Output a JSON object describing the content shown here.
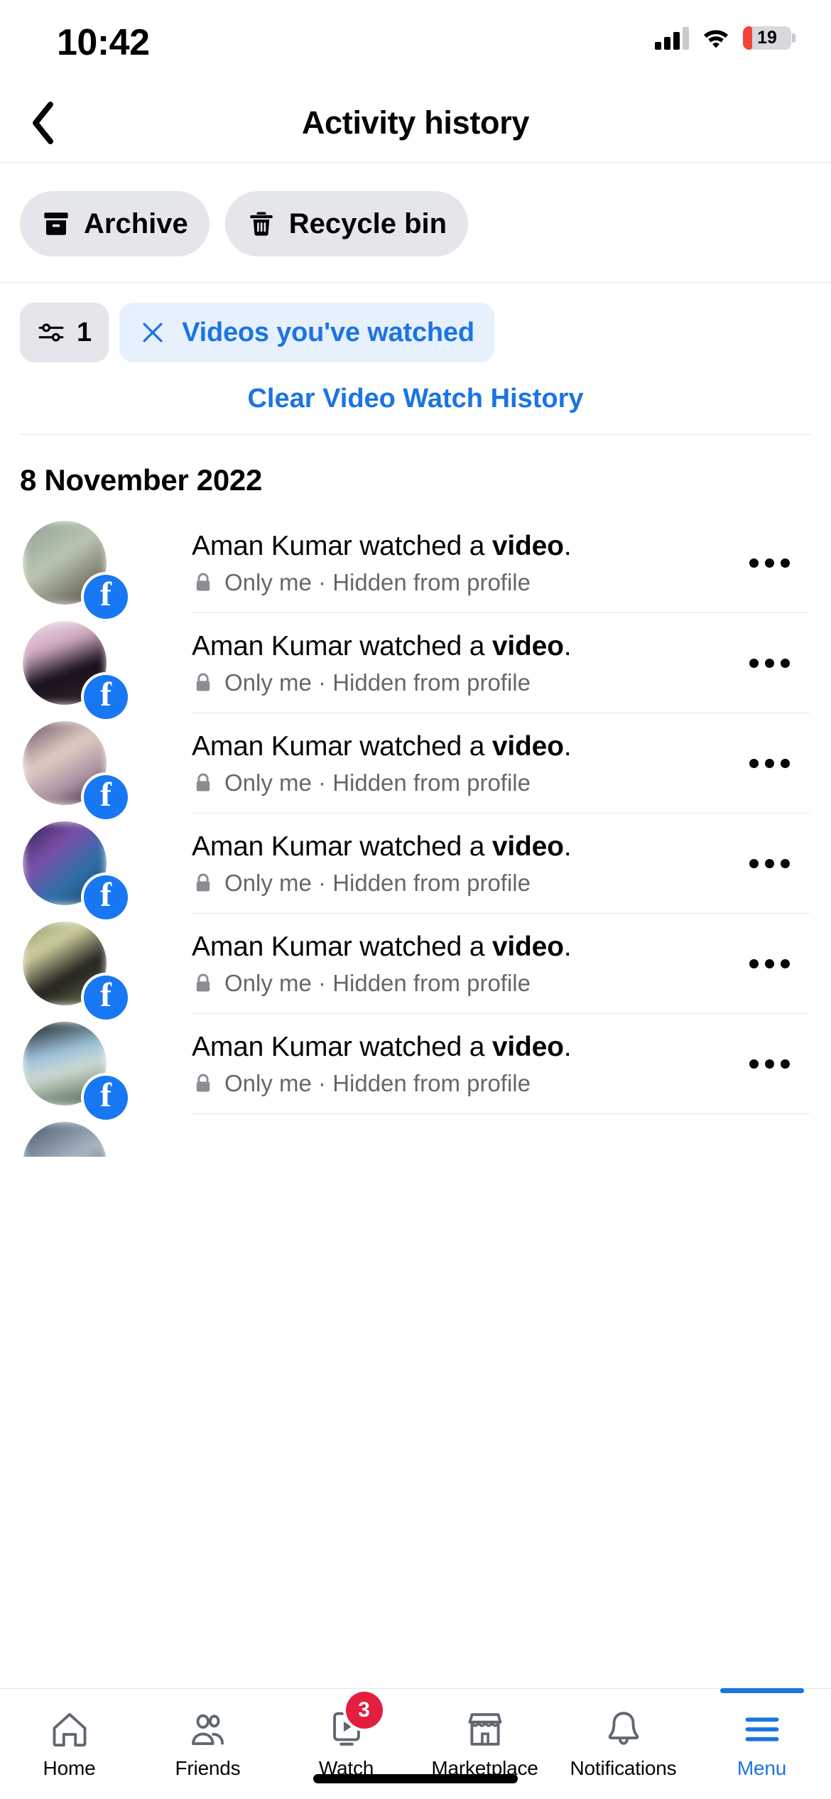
{
  "status_bar": {
    "time": "10:42",
    "battery_percent": "19",
    "battery_level_pct": 19,
    "signal_icon": "cellular-signal-icon",
    "wifi_icon": "wifi-icon",
    "battery_icon": "battery-low-icon"
  },
  "header": {
    "back_icon": "chevron-left-icon",
    "title": "Activity history"
  },
  "chips": [
    {
      "label": "Archive",
      "icon": "archive-box-icon"
    },
    {
      "label": "Recycle bin",
      "icon": "trash-can-icon"
    }
  ],
  "filters": {
    "filter_button": {
      "icon": "sliders-filter-icon",
      "count": "1"
    },
    "active_filter": {
      "close_icon": "close-x-icon",
      "label": "Videos you've watched"
    },
    "clear_link": "Clear Video Watch History"
  },
  "sections": [
    {
      "date": "8 November 2022",
      "items": [
        {
          "avatar_colors": [
            "#8e9e92",
            "#b9c6b0",
            "#4c4038"
          ],
          "badge_icon": "facebook-badge-icon",
          "text_prefix": "Aman Kumar watched a ",
          "text_bold": "video",
          "text_suffix": ".",
          "privacy_icon": "lock-icon",
          "meta": "Only me  ·  Hidden from profile",
          "menu_icon": "more-options-icon"
        },
        {
          "avatar_colors": [
            "#e8d7e3",
            "#1b1416",
            "#d9a7b8"
          ],
          "badge_icon": "facebook-badge-icon",
          "text_prefix": "Aman Kumar watched a ",
          "text_bold": "video",
          "text_suffix": ".",
          "privacy_icon": "lock-icon",
          "meta": "Only me  ·  Hidden from profile",
          "menu_icon": "more-options-icon"
        },
        {
          "avatar_colors": [
            "#5a4050",
            "#d9c6bb",
            "#2a1f28"
          ],
          "badge_icon": "facebook-badge-icon",
          "text_prefix": "Aman Kumar watched a ",
          "text_bold": "video",
          "text_suffix": ".",
          "privacy_icon": "lock-icon",
          "meta": "Only me  ·  Hidden from profile",
          "menu_icon": "more-options-icon"
        },
        {
          "avatar_colors": [
            "#3b2a63",
            "#7a4fa8",
            "#2e6fa8"
          ],
          "badge_icon": "facebook-badge-icon",
          "text_prefix": "Aman Kumar watched a ",
          "text_bold": "video",
          "text_suffix": ".",
          "privacy_icon": "lock-icon",
          "meta": "Only me  ·  Hidden from profile",
          "menu_icon": "more-options-icon"
        },
        {
          "avatar_colors": [
            "#7e8a63",
            "#2c2c2c",
            "#b9b58c"
          ],
          "badge_icon": "facebook-badge-icon",
          "text_prefix": "Aman Kumar watched a ",
          "text_bold": "video",
          "text_suffix": ".",
          "privacy_icon": "lock-icon",
          "meta": "Only me  ·  Hidden from profile",
          "menu_icon": "more-options-icon"
        },
        {
          "avatar_colors": [
            "#1a1a1a",
            "#8fb7d4",
            "#4a6a4f"
          ],
          "badge_icon": "facebook-badge-icon",
          "text_prefix": "Aman Kumar watched a ",
          "text_bold": "video",
          "text_suffix": ".",
          "privacy_icon": "lock-icon",
          "meta": "Only me  ·  Hidden from profile",
          "menu_icon": "more-options-icon"
        }
      ]
    }
  ],
  "bottom_nav": {
    "items": [
      {
        "label": "Home",
        "icon": "home-icon",
        "active": false,
        "badge": ""
      },
      {
        "label": "Friends",
        "icon": "friends-icon",
        "active": false,
        "badge": ""
      },
      {
        "label": "Watch",
        "icon": "watch-video-icon",
        "active": false,
        "badge": "3"
      },
      {
        "label": "Marketplace",
        "icon": "marketplace-store-icon",
        "active": false,
        "badge": ""
      },
      {
        "label": "Notifications",
        "icon": "bell-icon",
        "active": false,
        "badge": ""
      },
      {
        "label": "Menu",
        "icon": "hamburger-menu-icon",
        "active": true,
        "badge": ""
      }
    ],
    "accent_color": "#1b74e4"
  }
}
